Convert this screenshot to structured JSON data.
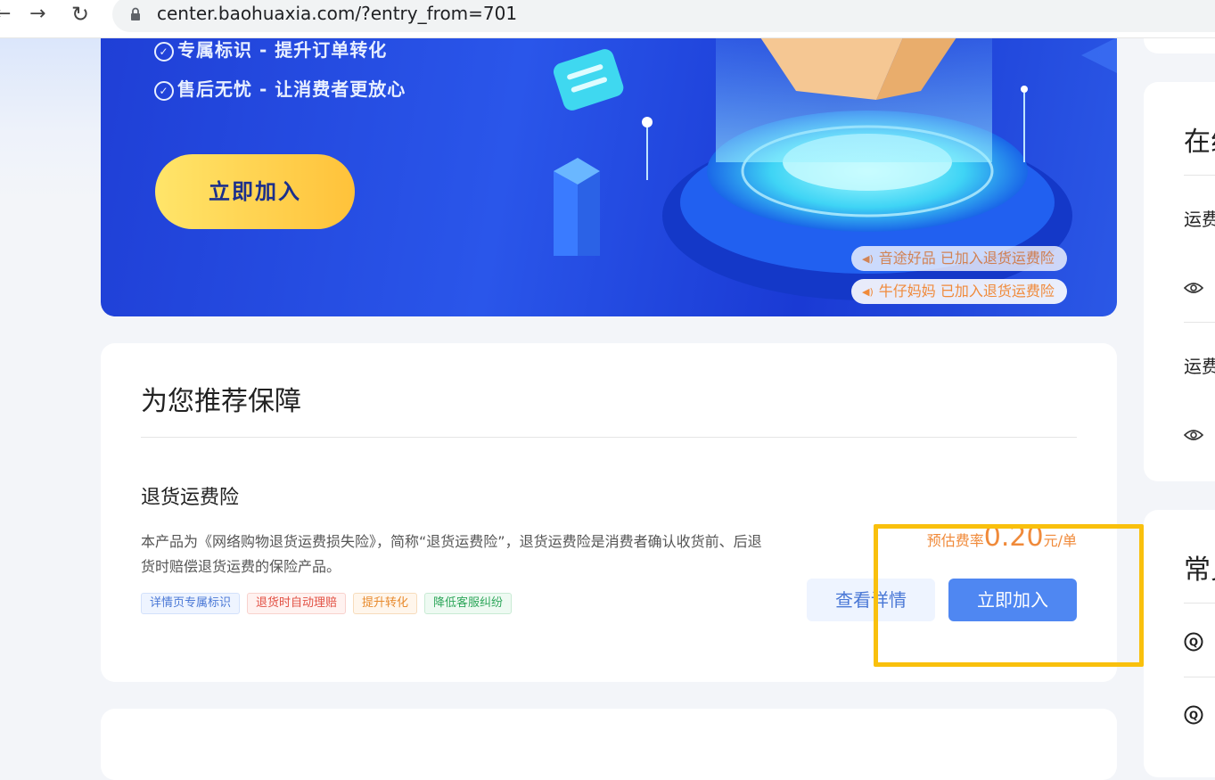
{
  "browser": {
    "url": "center.baohuaxia.com/?entry_from=701"
  },
  "banner": {
    "benefits": [
      "专属标识 - 提升订单转化",
      "售后无忧 - 让消费者更放心"
    ],
    "cta_label": "立即加入",
    "ticker": [
      "音途好品 已加入退货运费险",
      "牛仔妈妈 已加入退货运费险"
    ]
  },
  "recommend": {
    "title": "为您推荐保障",
    "product": {
      "name": "退货运费险",
      "description": "本产品为《网络购物退货运费损失险》，简称“退货运费险”，退货运费险是消费者确认收货前、后退货时赔偿退货运费的保险产品。",
      "tags": [
        "详情页专属标识",
        "退货时自动理赔",
        "提升转化",
        "降低客服纠纷"
      ],
      "rate_label": "预估费率",
      "rate_value": "0.20",
      "rate_unit": "元/单",
      "detail_button": "查看详情",
      "join_button": "立即加入"
    }
  },
  "side": {
    "card1_title": "在线",
    "card1_items": [
      "运费",
      "运费"
    ],
    "card2_title": "常见"
  },
  "colors": {
    "accent": "#4f87f2",
    "orange": "#f08a3a",
    "highlight": "#f9c00c",
    "banner_blue": "#2a56ea"
  }
}
